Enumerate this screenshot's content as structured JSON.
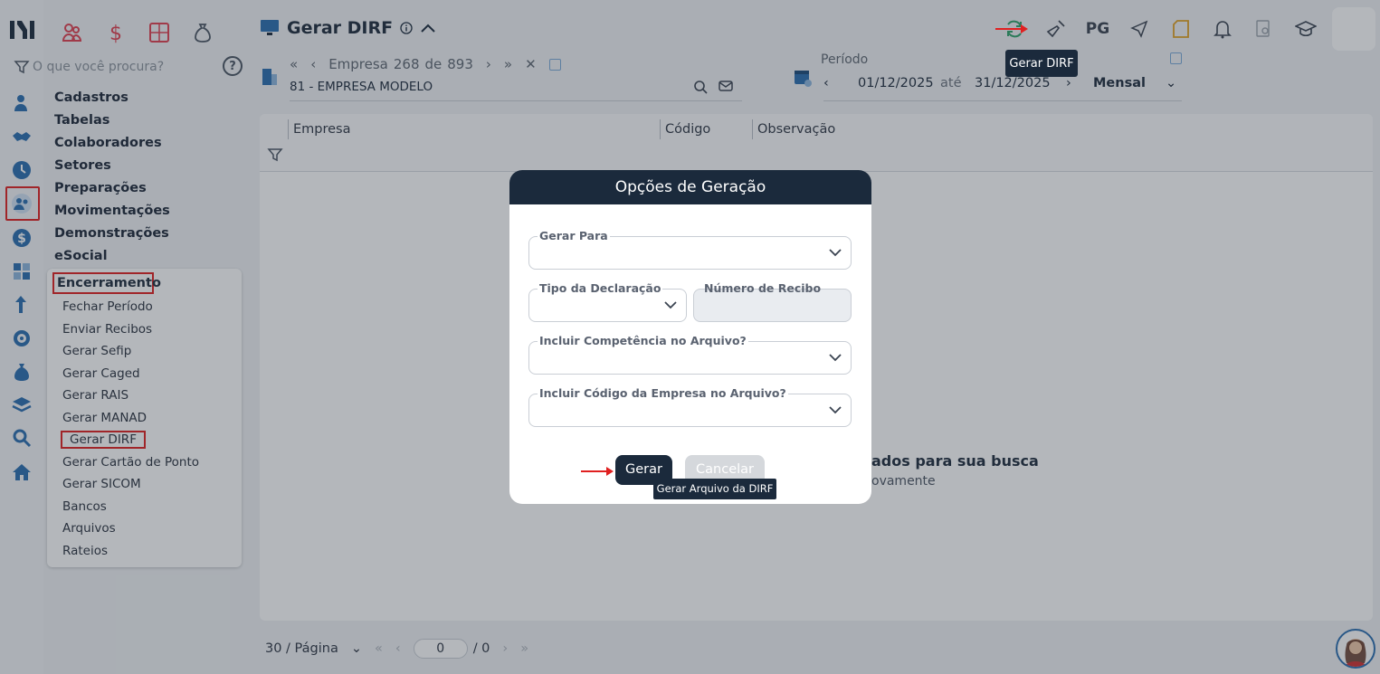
{
  "search": {
    "placeholder": "O que você procura?",
    "help": "?"
  },
  "menu": [
    "Cadastros",
    "Tabelas",
    "Colaboradores",
    "Setores",
    "Preparações",
    "Movimentações",
    "Demonstrações",
    "eSocial"
  ],
  "submenu": {
    "header": "Encerramento",
    "items": [
      "Fechar Período",
      "Enviar Recibos",
      "Gerar Sefip",
      "Gerar Caged",
      "Gerar RAIS",
      "Gerar MANAD",
      "Gerar DIRF",
      "Gerar Cartão de Ponto",
      "Gerar SICOM",
      "Bancos",
      "Arquivos",
      "Rateios"
    ]
  },
  "header": {
    "title": "Gerar DIRF"
  },
  "empresa": {
    "label": "Empresa",
    "current": "268",
    "of": "de",
    "total": "893",
    "name": "81 - EMPRESA MODELO"
  },
  "periodo": {
    "label": "Período",
    "start": "01/12/2025",
    "sep": "até",
    "end": "31/12/2025",
    "mode": "Mensal"
  },
  "toolbar": {
    "pg": "PG",
    "tooltip": "Gerar DIRF"
  },
  "table": {
    "columns": [
      "Empresa",
      "Código",
      "Observação"
    ],
    "empty_title": "ados para sua busca",
    "empty_sub": "ovamente"
  },
  "pager": {
    "per_page": "30 / Página",
    "page": "0",
    "total": "/ 0"
  },
  "modal": {
    "title": "Opções de Geração",
    "fields": {
      "gerar_para": "Gerar Para",
      "tipo": "Tipo da Declaração",
      "recibo": "Número de Recibo",
      "competencia": "Incluir Competência no Arquivo?",
      "codigo": "Incluir Código da Empresa no Arquivo?"
    },
    "gerar": "Gerar",
    "cancelar": "Cancelar",
    "tooltip": "Gerar Arquivo da DIRF"
  },
  "colors": {
    "dark": "#1b2a3c",
    "red": "#e02020",
    "accent_blue": "#2a6db0",
    "green": "#2fa36b"
  }
}
